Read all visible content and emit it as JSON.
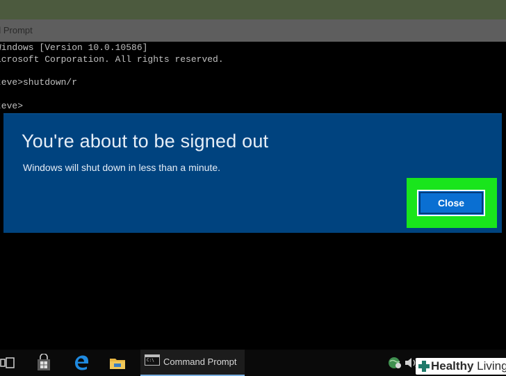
{
  "window": {
    "title": "d Prompt"
  },
  "console": {
    "lines": [
      "Windows [Version 10.0.10586]",
      "icrosoft Corporation. All rights reserved.",
      "",
      "teve>shutdown/r",
      "",
      "teve>"
    ]
  },
  "dialog": {
    "title": "You're about to be signed out",
    "message": "Windows will shut down in less than a minute.",
    "close_label": "Close"
  },
  "taskbar": {
    "items": [
      {
        "icon": "task-view-icon"
      },
      {
        "icon": "store-icon"
      },
      {
        "icon": "edge-icon"
      },
      {
        "icon": "file-explorer-icon"
      }
    ],
    "active_app_label": "Command Prompt",
    "tray_icons": [
      "network-icon",
      "volume-icon"
    ]
  },
  "watermark": {
    "bold": "Healthy",
    "thin": "Living"
  },
  "colors": {
    "dialog_bg": "#00437f",
    "highlight": "#19e51c",
    "button": "#0a6fd2"
  }
}
